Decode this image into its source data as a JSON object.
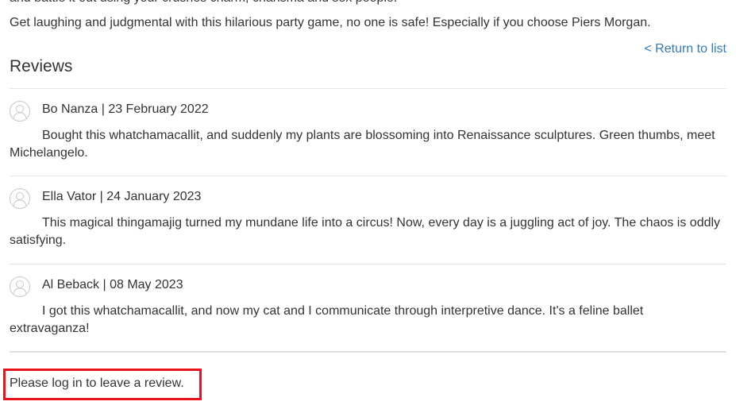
{
  "product": {
    "description_partial": "and battle it out using your crushes charm, charisma and sex people.",
    "description": "Get laughing and judgmental with this hilarious party game, no one is safe! Especially if you choose Piers Morgan."
  },
  "nav": {
    "return_label": "< Return to list"
  },
  "reviews": {
    "heading": "Reviews",
    "items": [
      {
        "author": "Bo Nanza",
        "separator": " | ",
        "date": "23 February 2022",
        "meta": "Bo Nanza | 23 February 2022",
        "body": "Bought this whatchamacallit, and suddenly my plants are blossoming into Renaissance sculptures. Green thumbs, meet Michelangelo."
      },
      {
        "author": "Ella Vator",
        "separator": " | ",
        "date": "24 January 2023",
        "meta": "Ella Vator | 24 January 2023",
        "body": "This magical thingamajig turned my mundane life into a circus! Now, every day is a juggling act of joy. The chaos is oddly satisfying."
      },
      {
        "author": "Al Beback",
        "separator": " | ",
        "date": "08 May 2023",
        "meta": "Al Beback | 08 May 2023",
        "body": "I got this whatchamacallit, and now my cat and I communicate through interpretive dance. It's a feline ballet extravaganza!"
      }
    ]
  },
  "login": {
    "message": "Please log in to leave a review."
  },
  "colors": {
    "link": "#337ab7",
    "highlight": "#e8141c",
    "text": "#333333",
    "divider": "#e5e5e5",
    "avatar": "#c8c8c8"
  },
  "icons": {
    "avatar": "user-avatar-icon"
  }
}
